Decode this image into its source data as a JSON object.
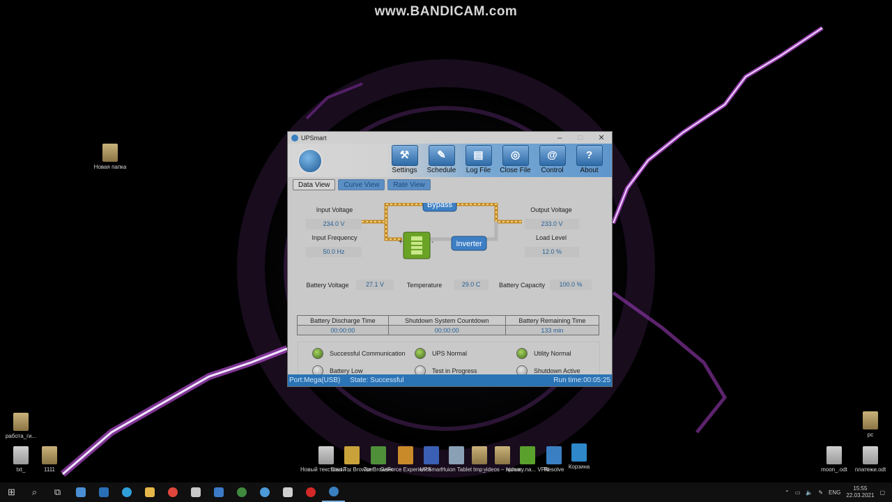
{
  "watermark": "www.BANDICAM.com",
  "desktop_icons": [
    {
      "label": "Новая папка",
      "kind": "folder"
    },
    {
      "label": "работа_ги...",
      "kind": "folder"
    },
    {
      "label": "txt_",
      "kind": "doc"
    },
    {
      "label": "1111",
      "kind": "folder"
    },
    {
      "label": "Новый текстовый ...",
      "kind": "doc"
    },
    {
      "label": "Start Tor Browser",
      "kind": "app"
    },
    {
      "label": "Tor Browser",
      "kind": "app"
    },
    {
      "label": "GeForce Experience",
      "kind": "app"
    },
    {
      "label": "UPSmart",
      "kind": "app"
    },
    {
      "label": "Huion Tablet",
      "kind": "app"
    },
    {
      "label": "tmp_",
      "kind": "folder"
    },
    {
      "label": "videos – ярлык",
      "kind": "folder"
    },
    {
      "label": "hidemy.na... VPN",
      "kind": "app"
    },
    {
      "label": "Resolve",
      "kind": "app"
    },
    {
      "label": "Корзина",
      "kind": "app"
    },
    {
      "label": "рс",
      "kind": "folder"
    },
    {
      "label": "moon_.odt",
      "kind": "doc"
    },
    {
      "label": "платежи.odt",
      "kind": "doc"
    }
  ],
  "window": {
    "title": "UPSmart",
    "controls": {
      "minimize": "–",
      "maximize": "□",
      "close": "✕"
    },
    "toolbar": [
      {
        "label": "Settings",
        "icon": "settings-icon",
        "glyph": "⚒"
      },
      {
        "label": "Schedule",
        "icon": "schedule-icon",
        "glyph": "✎"
      },
      {
        "label": "Log File",
        "icon": "log-file-icon",
        "glyph": "▤"
      },
      {
        "label": "Close File",
        "icon": "close-file-icon",
        "glyph": "◎"
      },
      {
        "label": "Control",
        "icon": "control-icon",
        "glyph": "@"
      },
      {
        "label": "About",
        "icon": "about-icon",
        "glyph": "?"
      }
    ],
    "tabs": [
      "Data View",
      "Curve View",
      "Rate View"
    ],
    "active_tab": "Data View",
    "flow": {
      "bypass": "Bypass",
      "inverter": "Inverter",
      "plus": "+",
      "minus": "-"
    },
    "readings": {
      "input_voltage": {
        "label": "Input Voltage",
        "value": "234.0 V"
      },
      "input_frequency": {
        "label": "Input Frequency",
        "value": "50.0 Hz"
      },
      "output_voltage": {
        "label": "Output Voltage",
        "value": "233.0 V"
      },
      "load_level": {
        "label": "Load Level",
        "value": "12.0 %"
      },
      "battery_voltage": {
        "label": "Battery Voltage",
        "value": "27.1 V"
      },
      "temperature": {
        "label": "Temperature",
        "value": "29.0 C"
      },
      "battery_capacity": {
        "label": "Battery Capacity",
        "value": "100.0 %"
      }
    },
    "timers": {
      "headers": [
        "Battery Discharge Time",
        "Shutdown System Countdown",
        "Battery Remaining Time"
      ],
      "values": [
        "00:00:00",
        "00:00:00",
        "133 min"
      ]
    },
    "status": [
      {
        "label": "Successful Communication",
        "on": true
      },
      {
        "label": "UPS Normal",
        "on": true
      },
      {
        "label": "Utility Normal",
        "on": true
      },
      {
        "label": "Battery Low",
        "on": false
      },
      {
        "label": "Test in Progress",
        "on": false
      },
      {
        "label": "Shutdown Active",
        "on": false
      }
    ],
    "statusbar": {
      "port": "Port:Mega(USB)",
      "state": "State: Successful",
      "runtime": "Run time:00:05:25"
    }
  },
  "taskbar": {
    "language": "ENG",
    "time": "15:55",
    "date": "22.03.2021"
  }
}
